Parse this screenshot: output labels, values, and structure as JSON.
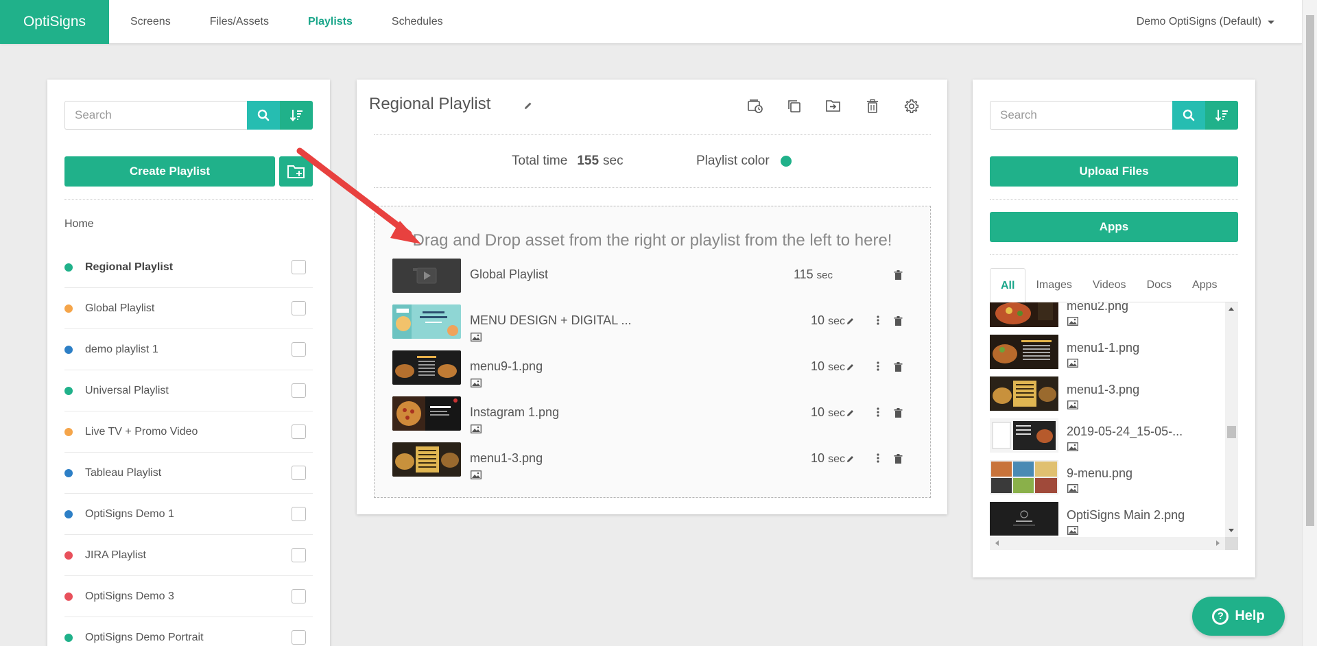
{
  "app": {
    "logo": "OptiSigns",
    "account": "Demo OptiSigns (Default)"
  },
  "nav": [
    {
      "label": "Screens",
      "active": false
    },
    {
      "label": "Files/Assets",
      "active": false
    },
    {
      "label": "Playlists",
      "active": true
    },
    {
      "label": "Schedules",
      "active": false
    }
  ],
  "left": {
    "search_placeholder": "Search",
    "create_label": "Create Playlist",
    "home_label": "Home",
    "playlists": [
      {
        "name": "Regional Playlist",
        "color": "#20b18a",
        "selected": true
      },
      {
        "name": "Global Playlist",
        "color": "#f5a54a",
        "selected": false
      },
      {
        "name": "demo playlist 1",
        "color": "#2d7fc6",
        "selected": false
      },
      {
        "name": "Universal Playlist",
        "color": "#20b18a",
        "selected": false
      },
      {
        "name": "Live TV + Promo Video",
        "color": "#f5a54a",
        "selected": false
      },
      {
        "name": "Tableau Playlist",
        "color": "#2d7fc6",
        "selected": false
      },
      {
        "name": "OptiSigns Demo 1",
        "color": "#2d7fc6",
        "selected": false
      },
      {
        "name": "JIRA Playlist",
        "color": "#e8505b",
        "selected": false
      },
      {
        "name": "OptiSigns Demo 3",
        "color": "#e8505b",
        "selected": false
      },
      {
        "name": "OptiSigns Demo Portrait",
        "color": "#20b18a",
        "selected": false
      }
    ]
  },
  "playlist": {
    "title": "Regional Playlist",
    "total_label": "Total time",
    "total_value": "155",
    "total_unit": "sec",
    "color_label": "Playlist color",
    "color": "#20b18a",
    "drop_hint": "Drag and Drop asset from the right or playlist from the left to here!",
    "items": [
      {
        "name": "Global Playlist",
        "duration": "115",
        "unit": "sec",
        "kind": "playlist",
        "thumb": "playlist-thumb"
      },
      {
        "name": "MENU DESIGN + DIGITAL ...",
        "duration": "10",
        "unit": "sec",
        "kind": "image",
        "thumb": "menu-design-thumb"
      },
      {
        "name": "menu9-1.png",
        "duration": "10",
        "unit": "sec",
        "kind": "image",
        "thumb": "burger-menu-thumb"
      },
      {
        "name": "Instagram 1.png",
        "duration": "10",
        "unit": "sec",
        "kind": "image",
        "thumb": "pizza-thumb"
      },
      {
        "name": "menu1-3.png",
        "duration": "10",
        "unit": "sec",
        "kind": "image",
        "thumb": "food-menu-thumb"
      }
    ]
  },
  "right": {
    "search_placeholder": "Search",
    "upload_label": "Upload Files",
    "apps_label": "Apps",
    "tabs": [
      {
        "label": "All",
        "active": true
      },
      {
        "label": "Images",
        "active": false
      },
      {
        "label": "Videos",
        "active": false
      },
      {
        "label": "Docs",
        "active": false
      },
      {
        "label": "Apps",
        "active": false
      }
    ],
    "assets": [
      {
        "name": "menu2.png",
        "thumb": "food-thumb"
      },
      {
        "name": "menu1-1.png",
        "thumb": "food-menu-thumb"
      },
      {
        "name": "menu1-3.png",
        "thumb": "food-menu-thumb"
      },
      {
        "name": "2019-05-24_15-05-...",
        "thumb": "menu-screenshot-thumb"
      },
      {
        "name": "9-menu.png",
        "thumb": "collage-thumb"
      },
      {
        "name": "OptiSigns Main 2.png",
        "thumb": "dark-logo-thumb"
      }
    ]
  },
  "help_label": "Help"
}
